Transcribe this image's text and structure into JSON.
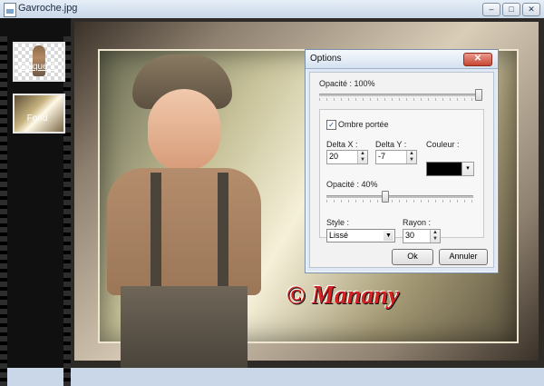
{
  "window": {
    "title": "Gavroche.jpg",
    "buttons": [
      "–",
      "□",
      "✕"
    ]
  },
  "layers": [
    {
      "name": "Calque 1",
      "type": "transparent-layer"
    },
    {
      "name": "Fond",
      "type": "background-layer"
    }
  ],
  "canvas": {
    "signature_text": "© Manany"
  },
  "dialog": {
    "title": "Options",
    "close_label": "✕",
    "opacity_label": "Opacité : 100%",
    "opacity_value": 100,
    "shadow_checkbox_label": "Ombre portée",
    "shadow_checked": true,
    "delta_x_label": "Delta X :",
    "delta_x_value": "20",
    "delta_y_label": "Delta Y :",
    "delta_y_value": "-7",
    "color_label": "Couleur :",
    "color_value": "#000000",
    "shadow_opacity_label": "Opacité : 40%",
    "shadow_opacity_value": 40,
    "style_label": "Style :",
    "style_value": "Lissé",
    "radius_label": "Rayon :",
    "radius_value": "30",
    "ok_label": "Ok",
    "cancel_label": "Annuler"
  }
}
